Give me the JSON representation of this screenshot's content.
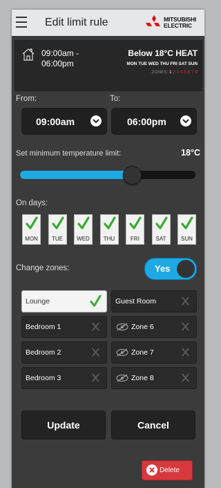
{
  "header": {
    "title": "Edit limit rule",
    "logo": "MITSUBISHI ELECTRIC",
    "menu_icon": "hamburger-menu-icon"
  },
  "schedule": {
    "icon": "house-icon",
    "time_start": "09:00am -",
    "time_end": "06:00pm",
    "temp_mode": "Below 18°C HEAT",
    "days": "MON TUE WED THU FRI SAT SUN",
    "zones_label": "ZONES:",
    "zones": [
      "1",
      "2",
      "3",
      "4",
      "5",
      "6",
      "7",
      "8"
    ]
  },
  "from": {
    "label": "From:",
    "value": "09:00am"
  },
  "to": {
    "label": "To:",
    "value": "06:00pm"
  },
  "min_temp": {
    "label": "Set minimum temperature limit:",
    "value": "18°C",
    "slider_fraction": 0.65
  },
  "on_days": {
    "label": "On days:",
    "days": [
      {
        "label": "MON",
        "checked": true
      },
      {
        "label": "TUE",
        "checked": true
      },
      {
        "label": "WED",
        "checked": true
      },
      {
        "label": "THU",
        "checked": true
      },
      {
        "label": "FRI",
        "checked": true
      },
      {
        "label": "SAT",
        "checked": true
      },
      {
        "label": "SUN",
        "checked": true
      }
    ]
  },
  "change_zones": {
    "label": "Change zones:",
    "toggle": "Yes"
  },
  "zones": [
    {
      "name": "Lounge",
      "selected": true
    },
    {
      "name": "Guest Room",
      "selected": false
    },
    {
      "name": "Bedroom 1",
      "selected": false
    },
    {
      "name": "Zone 6",
      "selected": false,
      "hidden": true
    },
    {
      "name": "Bedroom 2",
      "selected": false
    },
    {
      "name": "Zone 7",
      "selected": false,
      "hidden": true
    },
    {
      "name": "Bedroom 3",
      "selected": false
    },
    {
      "name": "Zone 8",
      "selected": false,
      "hidden": true
    }
  ],
  "actions": {
    "update": "Update",
    "cancel": "Cancel",
    "delete": "Delete"
  },
  "colors": {
    "accent": "#1ea9e4",
    "delete": "#d8393d",
    "brand": "#e60012",
    "check": "#3aaa35"
  }
}
